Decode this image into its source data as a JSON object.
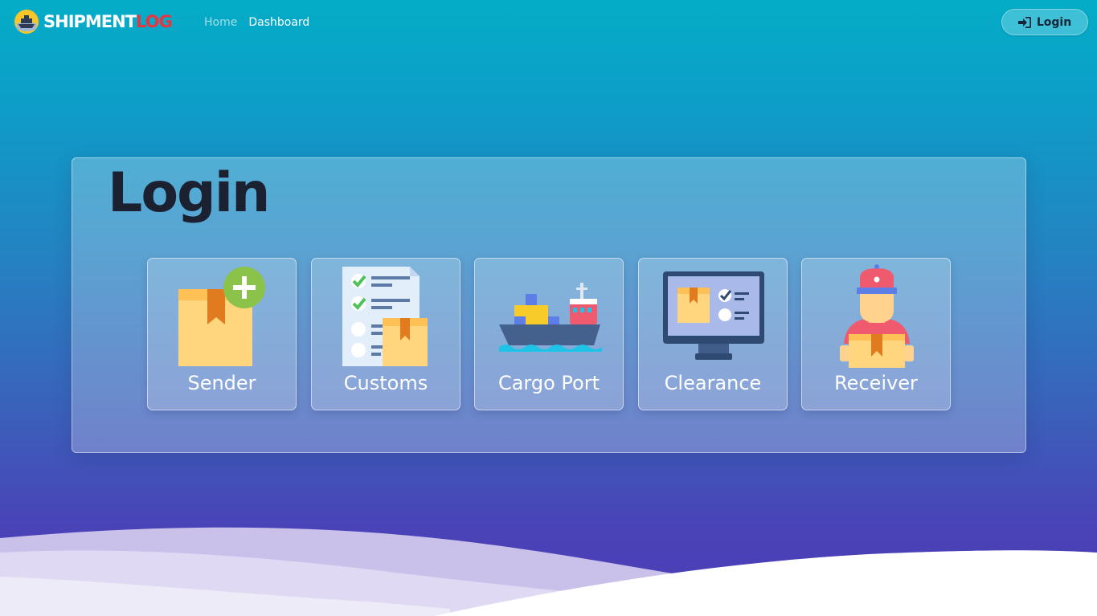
{
  "brand": {
    "part1": "SHIPMENT",
    "part2": "LOG"
  },
  "nav": {
    "links": [
      {
        "label": "Home"
      },
      {
        "label": "Dashboard"
      }
    ],
    "login_button": {
      "label": "Login",
      "icon": "sign-in-icon"
    }
  },
  "panel": {
    "title": "Login",
    "roles": [
      {
        "label": "Sender",
        "icon": "package-add-icon"
      },
      {
        "label": "Customs",
        "icon": "checklist-package-icon"
      },
      {
        "label": "Cargo Port",
        "icon": "cargo-ship-icon"
      },
      {
        "label": "Clearance",
        "icon": "monitor-checklist-icon"
      },
      {
        "label": "Receiver",
        "icon": "delivery-person-icon"
      }
    ]
  },
  "colors": {
    "gradient_top": "#04adc7",
    "gradient_bottom": "#4c3db6",
    "brand_accent": "#e9353f",
    "title_text": "#1b2131"
  }
}
